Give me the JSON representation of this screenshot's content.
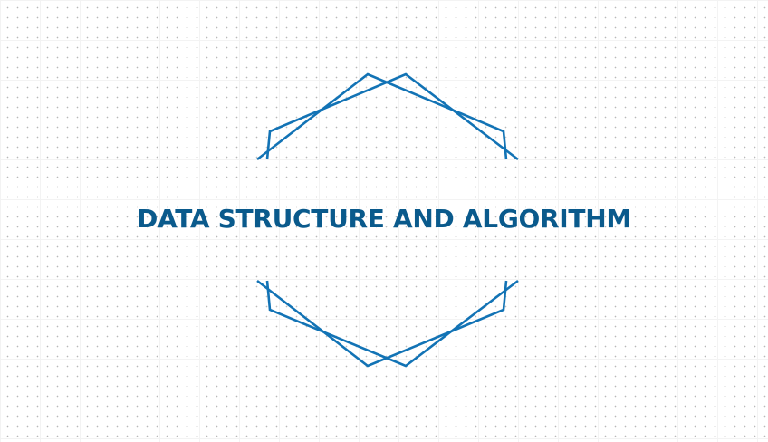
{
  "title": "DATA STRUCTURE AND ALGORITHM",
  "colors": {
    "title": "#0a5a8c",
    "frame_lines": "#1273b5",
    "grid_dots": "#b9b9b9"
  },
  "decoration": {
    "top": "double-chevron-frame",
    "bottom": "double-chevron-frame"
  }
}
